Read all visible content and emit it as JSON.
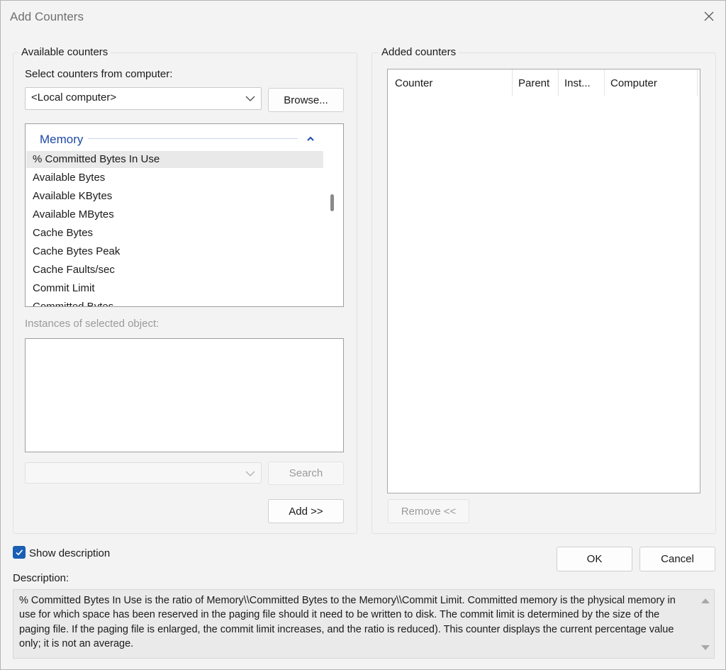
{
  "window": {
    "title": "Add Counters"
  },
  "available": {
    "group_label": "Available counters",
    "select_label": "Select counters from computer:",
    "computer_value": "<Local computer>",
    "browse_label": "Browse...",
    "category": "Memory",
    "counters": [
      "% Committed Bytes In Use",
      "Available Bytes",
      "Available KBytes",
      "Available MBytes",
      "Cache Bytes",
      "Cache Bytes Peak",
      "Cache Faults/sec",
      "Commit Limit",
      "Committed Bytes"
    ],
    "instances_label": "Instances of selected object:",
    "search_value": "",
    "search_label": "Search",
    "add_label": "Add >>"
  },
  "added": {
    "group_label": "Added counters",
    "columns": [
      "Counter",
      "Parent",
      "Inst...",
      "Computer"
    ],
    "remove_label": "Remove <<"
  },
  "show_description": {
    "label": "Show description",
    "checked": true
  },
  "ok_label": "OK",
  "cancel_label": "Cancel",
  "description": {
    "label": "Description:",
    "text": "% Committed Bytes In Use is the ratio of Memory\\\\Committed Bytes to the Memory\\\\Commit Limit. Committed memory is the physical memory in use for which space has been reserved in the paging file should it need to be written to disk. The commit limit is determined by the size of the paging file.  If the paging file is enlarged, the commit limit increases, and the ratio is reduced). This counter displays the current percentage value only; it is not an average."
  },
  "colors": {
    "accent": "#1a5fb4",
    "category": "#1f4aa8",
    "disabled_text": "#9a9a9a"
  }
}
